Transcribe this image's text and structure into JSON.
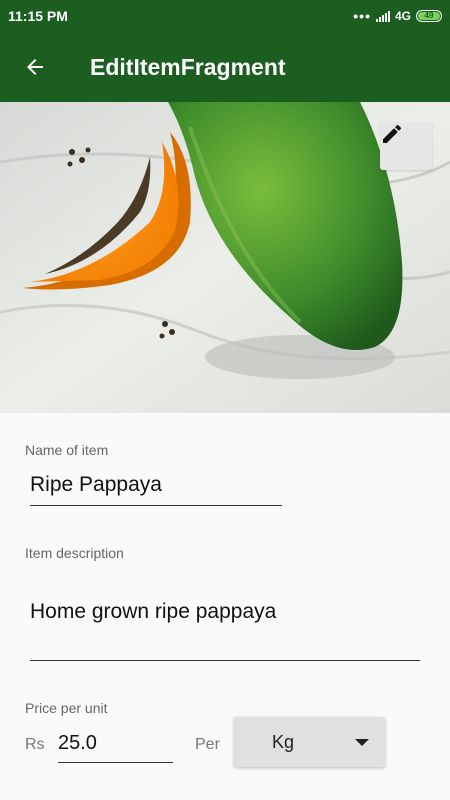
{
  "status_bar": {
    "time": "11:15 PM",
    "network": "4G",
    "battery": "49"
  },
  "app_bar": {
    "back_icon": "arrow-back-icon",
    "title": "EditItemFragment"
  },
  "hero": {
    "edit_icon": "pencil-icon"
  },
  "form": {
    "name_label": "Name of item",
    "name_value": "Ripe Pappaya",
    "description_label": "Item description",
    "description_value": "Home grown ripe pappaya",
    "price_label": "Price per unit",
    "currency": "Rs",
    "price_value": "25.0",
    "per_label": "Per",
    "unit_selected": "Kg"
  },
  "colors": {
    "primary": "#1b5e20"
  }
}
